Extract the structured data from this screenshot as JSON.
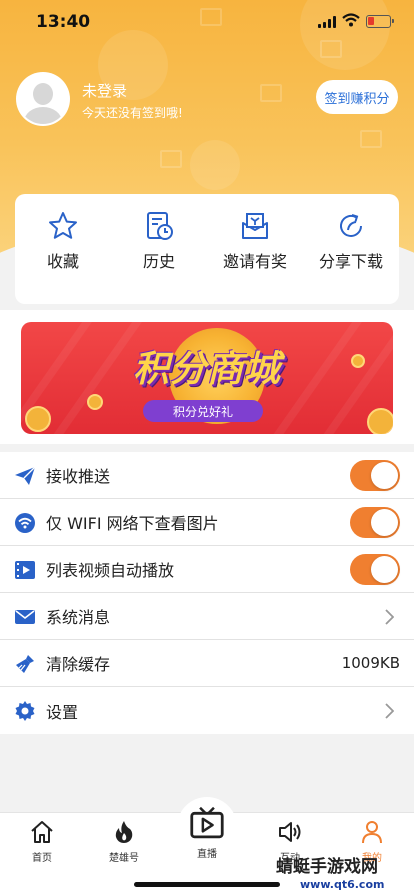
{
  "status_bar": {
    "time": "13:40"
  },
  "profile": {
    "name": "未登录",
    "subtitle": "今天还没有签到哦!",
    "sign_button": "签到赚积分"
  },
  "quick_actions": [
    {
      "label": "收藏",
      "icon": "star-icon"
    },
    {
      "label": "历史",
      "icon": "history-icon"
    },
    {
      "label": "邀请有奖",
      "icon": "invite-icon"
    },
    {
      "label": "分享下载",
      "icon": "share-icon"
    }
  ],
  "banner": {
    "title": "积分商城",
    "subtitle": "积分兑好礼"
  },
  "settings": [
    {
      "label": "接收推送",
      "icon": "send-icon",
      "control": "toggle",
      "on": true
    },
    {
      "label": "仅 WIFI 网络下查看图片",
      "icon": "wifi-icon",
      "control": "toggle",
      "on": true
    },
    {
      "label": "列表视频自动播放",
      "icon": "video-icon",
      "control": "toggle",
      "on": true
    },
    {
      "label": "系统消息",
      "icon": "mail-icon",
      "control": "chevron"
    },
    {
      "label": "清除缓存",
      "icon": "broom-icon",
      "control": "value",
      "value": "1009KB"
    },
    {
      "label": "设置",
      "icon": "gear-icon",
      "control": "chevron"
    }
  ],
  "tabbar": [
    {
      "label": "首页",
      "icon": "home-icon"
    },
    {
      "label": "楚雄号",
      "icon": "flame-icon"
    },
    {
      "label": "直播",
      "icon": "live-tv-icon"
    },
    {
      "label": "互动",
      "icon": "speaker-icon"
    },
    {
      "label": "我的",
      "icon": "user-icon",
      "active": true
    }
  ],
  "watermark": {
    "text": "蜻蜓手游戏网",
    "url": "www.qt6.com"
  },
  "colors": {
    "accent": "#f07f30",
    "header": "#f7b43f",
    "link": "#2a6fd8",
    "icon_blue": "#2a62c8"
  }
}
